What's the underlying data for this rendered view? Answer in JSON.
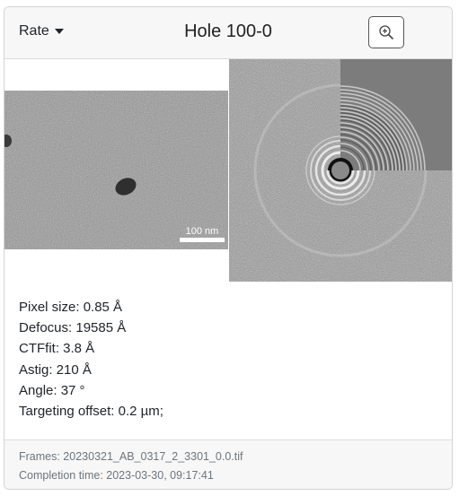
{
  "header": {
    "rate_label": "Rate",
    "title": "Hole 100-0",
    "zoom_icon": "zoom-in-icon"
  },
  "micrograph": {
    "scale_bar_label": "100 nm"
  },
  "stats": {
    "pixel_size": "Pixel size: 0.85 Å",
    "defocus": "Defocus: 19585 Å",
    "ctffit": "CTFfit: 3.8 Å",
    "astig": "Astig: 210 Å",
    "angle": "Angle: 37 °",
    "targeting_offset": "Targeting offset: 0.2 µm;"
  },
  "footer": {
    "frames": "Frames: 20230321_AB_0317_2_3301_0.0.tif",
    "completion_time": "Completion time: 2023-03-30, 09:17:41"
  }
}
